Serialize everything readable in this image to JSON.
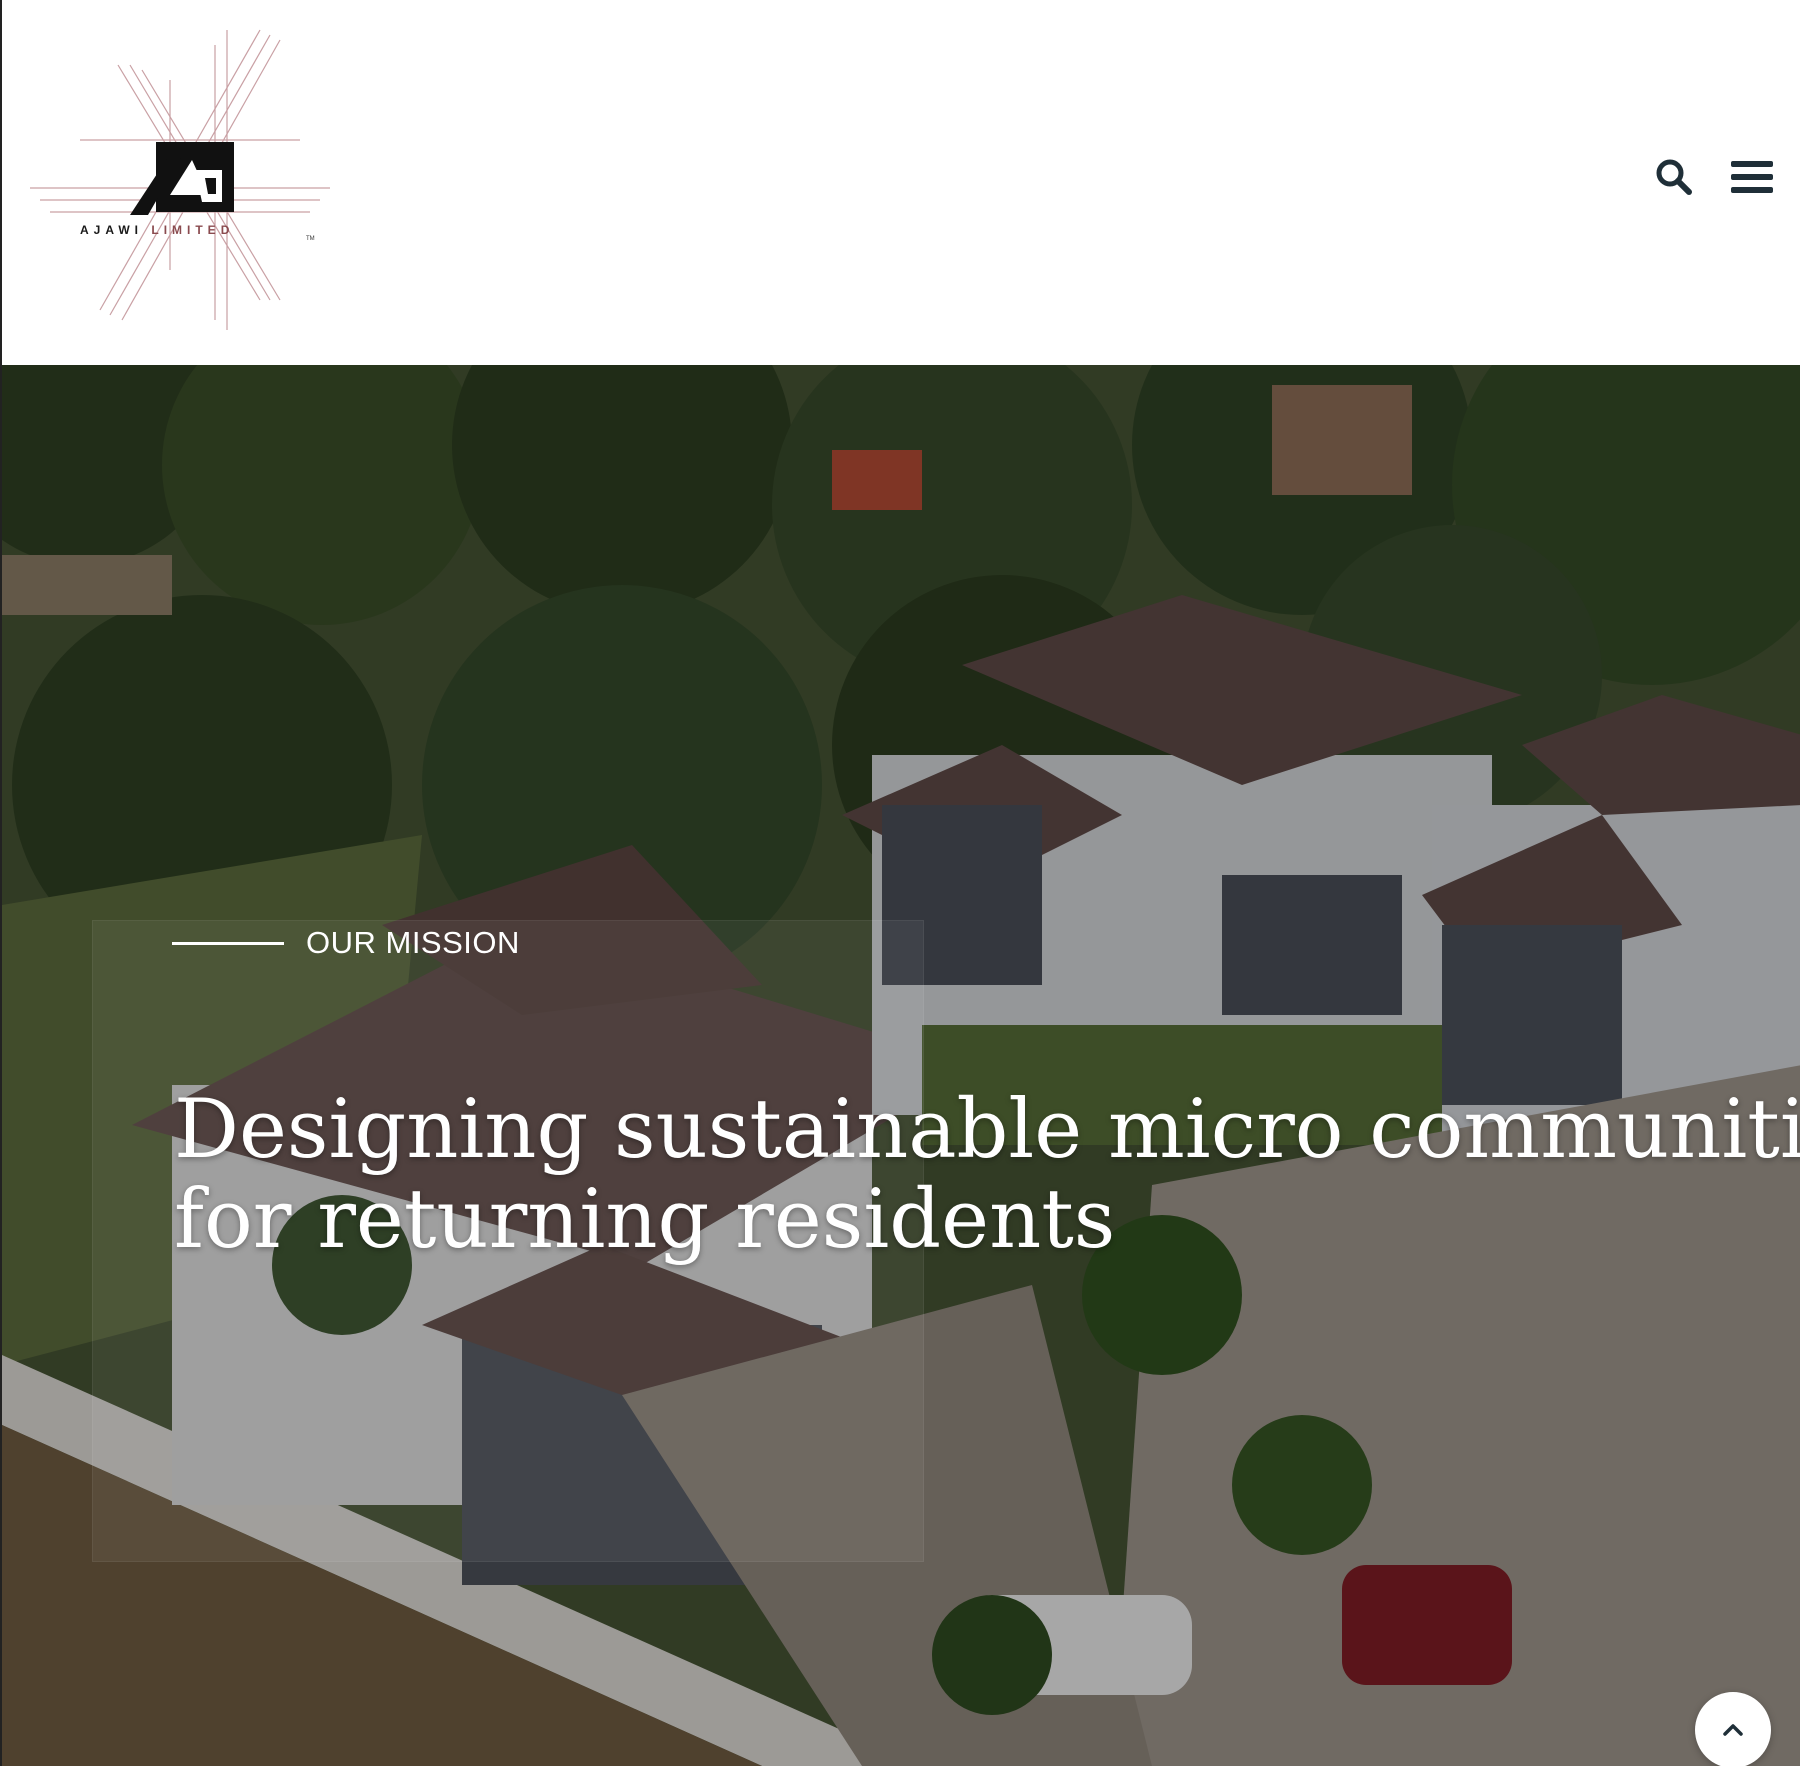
{
  "brand": {
    "name_part1": "AJAWI",
    "name_part2": "LIMITED",
    "trademark": "TM"
  },
  "header": {
    "search_icon": "search-icon",
    "menu_icon": "hamburger-menu-icon"
  },
  "hero": {
    "eyebrow": "OUR MISSION",
    "headline_line1": "Designing sustainable micro communities",
    "headline_line2": "for returning residents",
    "scroll_top_icon": "chevron-up-icon"
  },
  "colors": {
    "brand_dark": "#1a1a1a",
    "brand_accent": "#8a4b4f",
    "header_icon": "#1f2f38",
    "hero_text": "#ffffff"
  }
}
